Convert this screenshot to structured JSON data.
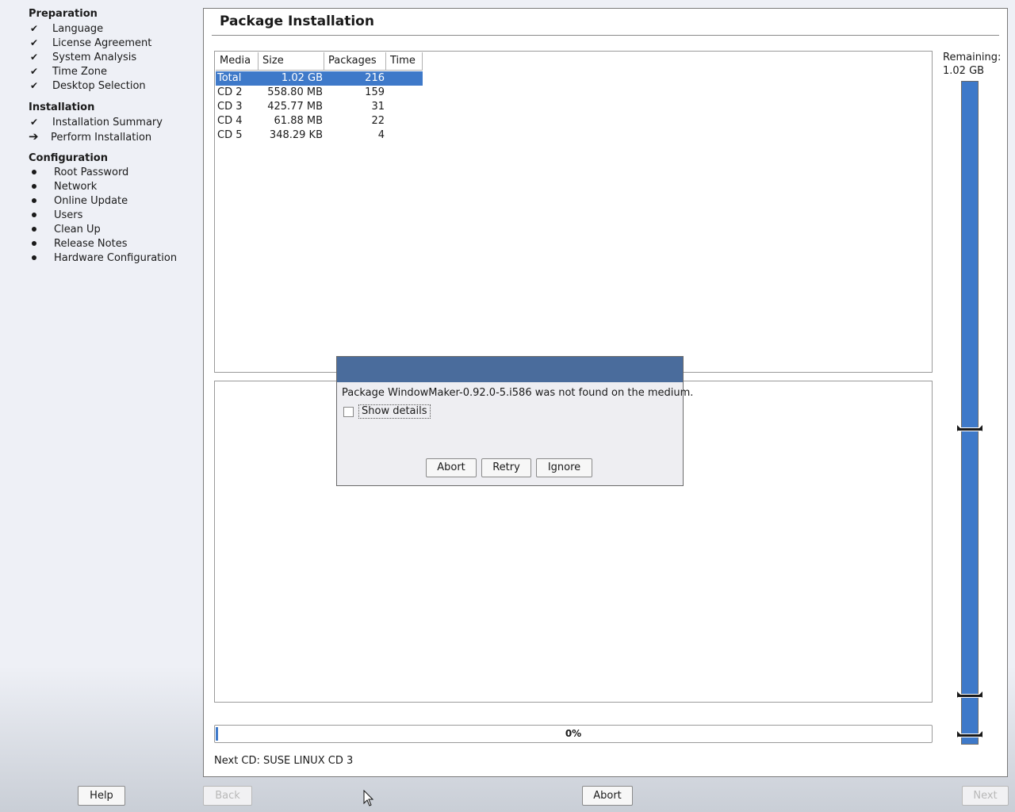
{
  "sidebar": {
    "sections": [
      {
        "title": "Preparation",
        "steps": [
          {
            "label": "Language",
            "state": "done"
          },
          {
            "label": "License Agreement",
            "state": "done"
          },
          {
            "label": "System Analysis",
            "state": "done"
          },
          {
            "label": "Time Zone",
            "state": "done"
          },
          {
            "label": "Desktop Selection",
            "state": "done"
          }
        ]
      },
      {
        "title": "Installation",
        "steps": [
          {
            "label": "Installation Summary",
            "state": "done"
          },
          {
            "label": "Perform Installation",
            "state": "current"
          }
        ]
      },
      {
        "title": "Configuration",
        "steps": [
          {
            "label": "Root Password",
            "state": "pending"
          },
          {
            "label": "Network",
            "state": "pending"
          },
          {
            "label": "Online Update",
            "state": "pending"
          },
          {
            "label": "Users",
            "state": "pending"
          },
          {
            "label": "Clean Up",
            "state": "pending"
          },
          {
            "label": "Release Notes",
            "state": "pending"
          },
          {
            "label": "Hardware Configuration",
            "state": "pending"
          }
        ]
      }
    ]
  },
  "main": {
    "title": "Package Installation",
    "table": {
      "headers": [
        "Media",
        "Size",
        "Packages",
        "Time"
      ],
      "rows": [
        [
          "Total",
          "1.02 GB",
          "216",
          ""
        ],
        [
          "CD 2",
          "558.80 MB",
          "159",
          ""
        ],
        [
          "CD 3",
          "425.77 MB",
          "31",
          ""
        ],
        [
          "CD 4",
          "61.88 MB",
          "22",
          ""
        ],
        [
          "CD 5",
          "348.29 KB",
          "4",
          ""
        ]
      ],
      "selected_row": 0
    },
    "remaining_label": "Remaining:",
    "remaining_value": "1.02 GB",
    "progress": {
      "percent": 0,
      "label": "0%"
    },
    "next_cd": "Next CD: SUSE LINUX CD 3"
  },
  "dialog": {
    "message": "Package WindowMaker-0.92.0-5.i586 was not found on the medium.",
    "show_details_label": "Show details",
    "show_details_checked": false,
    "buttons": {
      "abort": "Abort",
      "retry": "Retry",
      "ignore": "Ignore"
    }
  },
  "bottom": {
    "help": "Help",
    "back": "Back",
    "abort": "Abort",
    "next": "Next"
  },
  "colors": {
    "accent": "#3e79c9",
    "dialog_titlebar": "#4a6c9c"
  }
}
